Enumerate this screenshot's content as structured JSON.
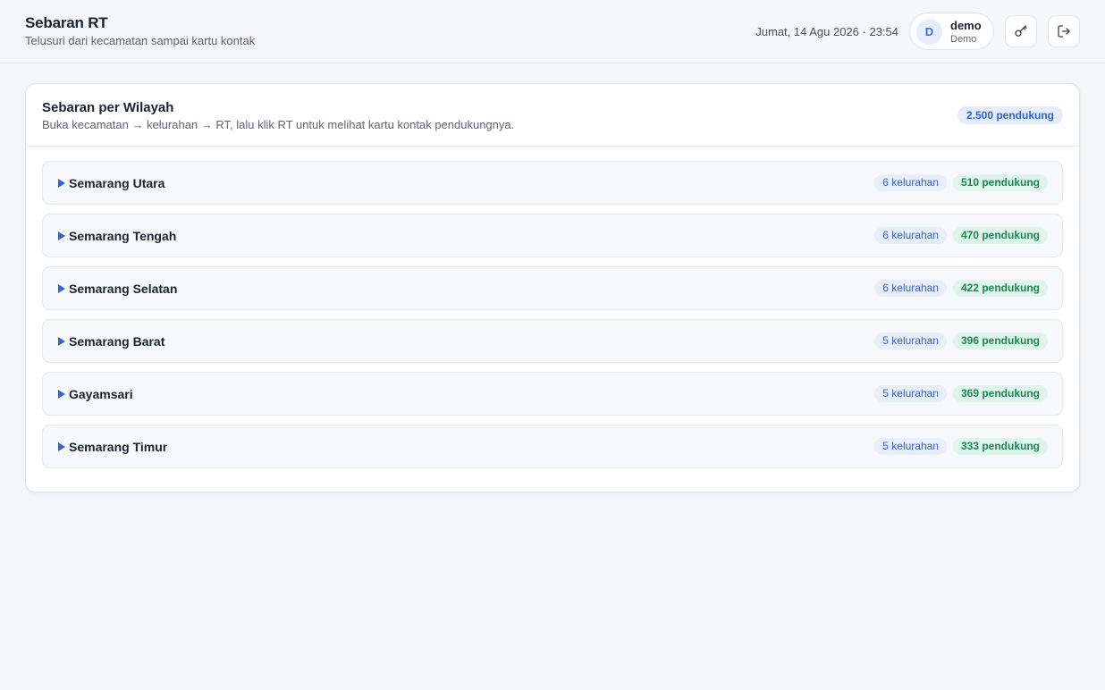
{
  "header": {
    "title": "Sebaran RT",
    "subtitle": "Telusuri dari kecamatan sampai kartu kontak",
    "datetime": "Jumat, 14 Agu 2026 · 23:54",
    "user": {
      "initial": "D",
      "name": "demo",
      "role": "Demo"
    },
    "icons": {
      "key": "key-icon",
      "logout": "logout-icon"
    }
  },
  "card": {
    "title": "Sebaran per Wilayah",
    "description": "Buka kecamatan → kelurahan → RT, lalu klik RT untuk melihat kartu kontak pendukungnya.",
    "total": "2.500 pendukung"
  },
  "regions": [
    {
      "name": "Semarang Utara",
      "kelurahan": "6 kelurahan",
      "pendukung": "510 pendukung"
    },
    {
      "name": "Semarang Tengah",
      "kelurahan": "6 kelurahan",
      "pendukung": "470 pendukung"
    },
    {
      "name": "Semarang Selatan",
      "kelurahan": "6 kelurahan",
      "pendukung": "422 pendukung"
    },
    {
      "name": "Semarang Barat",
      "kelurahan": "5 kelurahan",
      "pendukung": "396 pendukung"
    },
    {
      "name": "Gayamsari",
      "kelurahan": "5 kelurahan",
      "pendukung": "369 pendukung"
    },
    {
      "name": "Semarang Timur",
      "kelurahan": "5 kelurahan",
      "pendukung": "333 pendukung"
    }
  ],
  "colors": {
    "accent": "#2f66d4",
    "support_badge": "#1c8754",
    "background": "#f4f6fa"
  }
}
